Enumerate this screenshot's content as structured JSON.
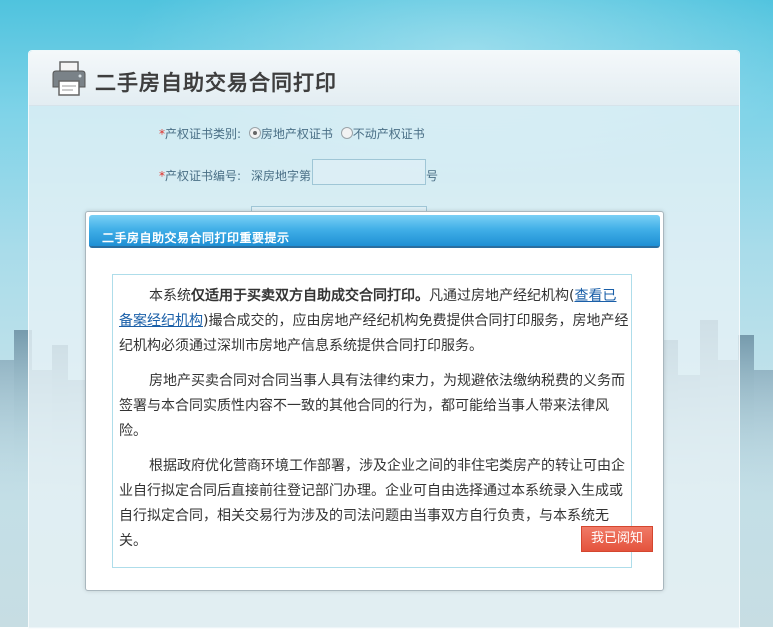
{
  "header": {
    "title": "二手房自助交易合同打印"
  },
  "form": {
    "cert_type": {
      "required_mark": "*",
      "label": "产权证书类别:",
      "options": [
        {
          "label": "房地产权证书",
          "checked": true
        },
        {
          "label": "不动产权证书",
          "checked": false
        }
      ]
    },
    "cert_number": {
      "required_mark": "*",
      "label": "产权证书编号:",
      "prefix": "深房地字第",
      "value": "",
      "suffix": "号"
    }
  },
  "modal": {
    "title": "二手房自助交易合同打印重要提示",
    "p1": {
      "pre": "本系统",
      "bold": "仅适用于买卖双方自助成交合同打印。",
      "mid": "凡通过房地产经纪机构(",
      "link": "查看已备案经纪机构",
      "post": ")撮合成交的，应由房地产经纪机构免费提供合同打印服务，房地产经纪机构必须通过深圳市房地产信息系统提供合同打印服务。"
    },
    "p2": "房地产买卖合同对合同当事人具有法律约束力，为规避依法缴纳税费的义务而签署与本合同实质性内容不一致的其他合同的行为，都可能给当事人带来法律风险。",
    "p3": "根据政府优化营商环境工作部署，涉及企业之间的非住宅类房产的转让可由企业自行拟定合同后直接前往登记部门办理。企业可自由选择通过本系统录入生成或自行拟定合同，相关交易行为涉及的司法问题由当事双方自行负责，与本系统无关。",
    "ack_label": "我已阅知"
  },
  "colors": {
    "required": "#e0312b",
    "modal_header": "#1e8fd4",
    "ack_button": "#e4533d",
    "link": "#1a5fa8"
  },
  "icons": {
    "header": "printer-icon"
  }
}
